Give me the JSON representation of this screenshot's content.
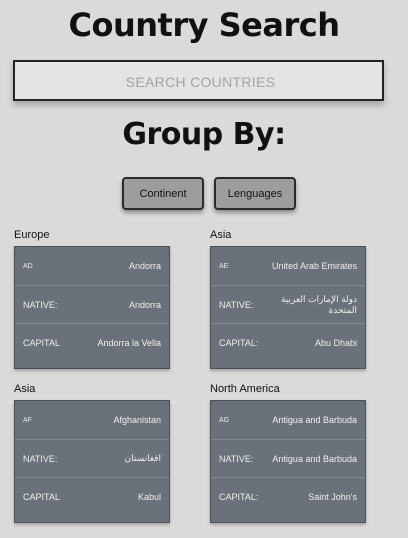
{
  "header": {
    "title": "Country Search"
  },
  "search": {
    "placeholder": "SEARCH COUNTRIES"
  },
  "group_by": {
    "heading": "Group By:",
    "buttons": [
      {
        "label": "Continent"
      },
      {
        "label": "Lenguages"
      }
    ]
  },
  "groups": [
    {
      "region": "Europe",
      "country": {
        "code": "AD",
        "name": "Andorra",
        "native_label": "NATIVE:",
        "native": "Andorra",
        "capital_label": "CAPITAL",
        "capital": "Andorra la Vella"
      }
    },
    {
      "region": "Asia",
      "country": {
        "code": "AE",
        "name": "United Arab Emirates",
        "native_label": "NATIVE:",
        "native": "دولة الإمارات العربية المتحدة",
        "capital_label": "CAPITAL:",
        "capital": "Abu Dhabi"
      }
    },
    {
      "region": "Asia",
      "country": {
        "code": "AF",
        "name": "Afghanistan",
        "native_label": "NATIVE:",
        "native": "افغانستان",
        "capital_label": "CAPITAL",
        "capital": "Kabul"
      }
    },
    {
      "region": "North America",
      "country": {
        "code": "AG",
        "name": "Antigua and Barbuda",
        "native_label": "NATIVE:",
        "native": "Antigua and Barbuda",
        "capital_label": "CAPITAL:",
        "capital": "Saint John's"
      }
    }
  ]
}
